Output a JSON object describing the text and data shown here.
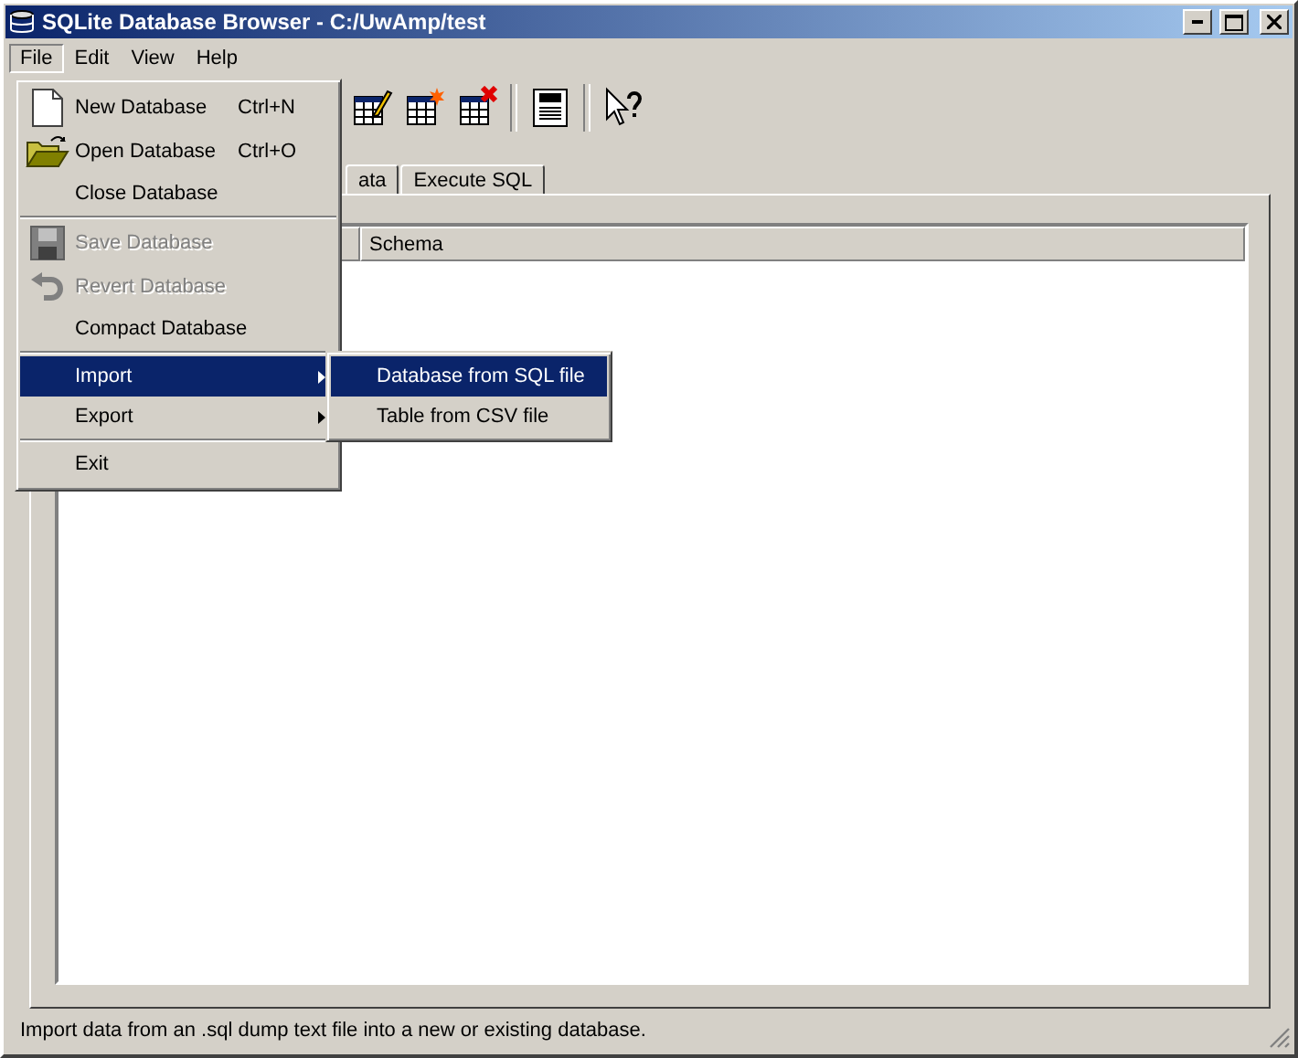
{
  "window": {
    "title": "SQLite Database Browser - C:/UwAmp/test"
  },
  "menubar": [
    {
      "label": "File",
      "selected": true
    },
    {
      "label": "Edit",
      "selected": false
    },
    {
      "label": "View",
      "selected": false
    },
    {
      "label": "Help",
      "selected": false
    }
  ],
  "tabs": [
    {
      "label": "ata",
      "selected": false
    },
    {
      "label": "Execute SQL",
      "selected": false
    }
  ],
  "table": {
    "columns": [
      "Schema"
    ]
  },
  "file_menu": {
    "items": [
      {
        "kind": "item",
        "label": "New Database",
        "shortcut": "Ctrl+N",
        "disabled": false,
        "selected": false
      },
      {
        "kind": "item",
        "label": "Open Database",
        "shortcut": "Ctrl+O",
        "disabled": false,
        "selected": false
      },
      {
        "kind": "item",
        "label": "Close Database",
        "disabled": false,
        "selected": false
      },
      {
        "kind": "separator"
      },
      {
        "kind": "item",
        "label": "Save Database",
        "disabled": true,
        "selected": false
      },
      {
        "kind": "item",
        "label": "Revert Database",
        "disabled": true,
        "selected": false
      },
      {
        "kind": "item",
        "label": "Compact Database",
        "disabled": false,
        "selected": false
      },
      {
        "kind": "separator"
      },
      {
        "kind": "submenu",
        "label": "Import",
        "disabled": false,
        "selected": true
      },
      {
        "kind": "submenu",
        "label": "Export",
        "disabled": false,
        "selected": false
      },
      {
        "kind": "separator"
      },
      {
        "kind": "item",
        "label": "Exit",
        "disabled": false,
        "selected": false
      }
    ]
  },
  "import_submenu": {
    "items": [
      {
        "label": "Database from SQL file",
        "selected": true
      },
      {
        "label": "Table from CSV file",
        "selected": false
      }
    ]
  },
  "status_bar": "Import data from an .sql dump text file into a new or existing database."
}
